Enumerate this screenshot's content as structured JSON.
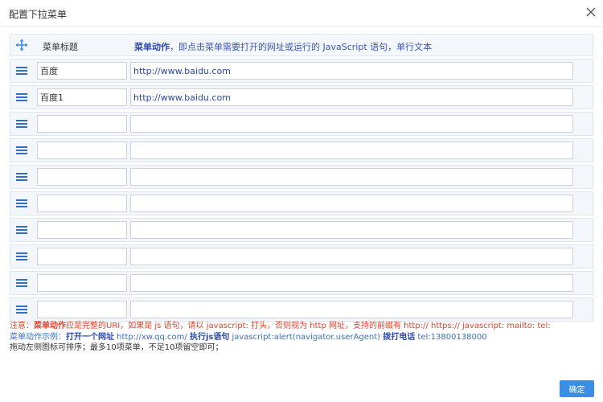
{
  "dialog": {
    "title": "配置下拉菜单",
    "confirm_label": "确定"
  },
  "table": {
    "header_title": "菜单标题",
    "header_action_bold": "菜单动作",
    "header_action_rest": "，即点击菜单需要打开的网址或运行的 JavaScript 语句，单行文本"
  },
  "rows": [
    {
      "title": "百度",
      "action": "http://www.baidu.com"
    },
    {
      "title": "百度1",
      "action": "http://www.baidu.com"
    },
    {
      "title": "",
      "action": ""
    },
    {
      "title": "",
      "action": ""
    },
    {
      "title": "",
      "action": ""
    },
    {
      "title": "",
      "action": ""
    },
    {
      "title": "",
      "action": ""
    },
    {
      "title": "",
      "action": ""
    },
    {
      "title": "",
      "action": ""
    },
    {
      "title": "",
      "action": ""
    }
  ],
  "notes": {
    "line1_prefix": "注意：",
    "line1_bold": "菜单动作",
    "line1_rest": "应是完整的URI，如果是 js 语句，请以 javascript: 打头，否则视为 http 网址，支持的前缀有 http://   https://   javascript:   mailto:   tel:",
    "line2_prefix": "菜单动作示例：",
    "line2_label1": "打开一个网址",
    "line2_value1": " http://xw.qq.com/   ",
    "line2_label2": "执行js语句",
    "line2_value2": " javascript:alert(navigator.userAgent)   ",
    "line2_label3": "拨打电话",
    "line2_value3": " tel:13800138000",
    "line3": "拖动左侧图标可排序；最多10项菜单，不足10项留空即可；"
  },
  "colors": {
    "accent": "#3a8ee6",
    "header_link": "#2b48b0",
    "warning": "#e0402a",
    "example": "#3a6cc8"
  },
  "icons": {
    "header_handle": "move-arrows-icon",
    "row_handle": "drag-handle-icon",
    "close": "close-icon"
  }
}
